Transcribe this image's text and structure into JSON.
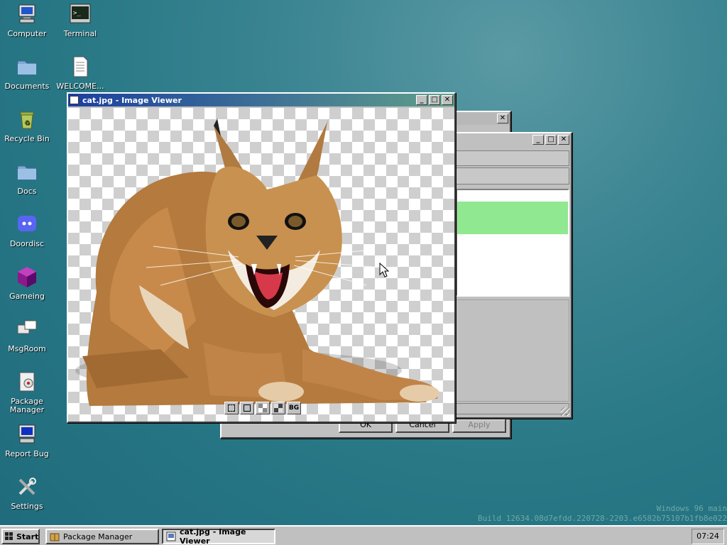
{
  "desktop": {
    "icons": [
      {
        "label": "Computer"
      },
      {
        "label": "Terminal"
      },
      {
        "label": "Documents"
      },
      {
        "label": "WELCOME..."
      },
      {
        "label": "Recycle Bin"
      },
      {
        "label": "Docs"
      },
      {
        "label": "Doordisc"
      },
      {
        "label": "Gameing"
      },
      {
        "label": "MsgRoom"
      },
      {
        "label": "Package Manager"
      },
      {
        "label": "Report Bug"
      },
      {
        "label": "Settings"
      }
    ],
    "watermark": {
      "line1": "Windows 96 main",
      "line2": "Build 12634.08d7efdd.220728-2203.e6582b75107b1fb8e022"
    }
  },
  "image_viewer": {
    "title": "cat.jpg - Image Viewer",
    "tools": [
      "fit-icon",
      "actual-size-icon",
      "checker-light-icon",
      "checker-dark-icon"
    ],
    "bg_label": "BG"
  },
  "dialog": {
    "ok": "OK",
    "cancel": "Cancel",
    "apply": "Apply"
  },
  "taskbar": {
    "start": "Start",
    "tasks": [
      {
        "label": "Package Manager"
      },
      {
        "label": "cat.jpg - Image Viewer"
      }
    ],
    "clock": "07:24"
  },
  "colors": {
    "title_active_start": "#1b3fa1",
    "title_active_end": "#5ea08a",
    "selection_green": "#90e890"
  }
}
